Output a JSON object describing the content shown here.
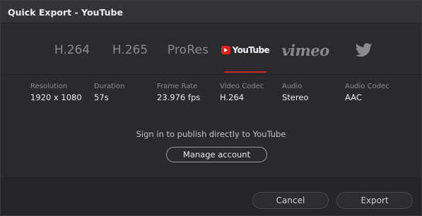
{
  "window": {
    "title": "Quick Export - YouTube"
  },
  "tabs": [
    {
      "label": "H.264",
      "icon": null,
      "selected": false
    },
    {
      "label": "H.265",
      "icon": null,
      "selected": false
    },
    {
      "label": "ProRes",
      "icon": null,
      "selected": false
    },
    {
      "label": "YouTube",
      "icon": "youtube-logo",
      "selected": true
    },
    {
      "label": "vimeo",
      "icon": "vimeo-logo",
      "selected": false
    },
    {
      "label": "",
      "icon": "twitter-bird-icon",
      "selected": false
    }
  ],
  "details": {
    "resolution": {
      "label": "Resolution",
      "value": "1920 x 1080"
    },
    "duration": {
      "label": "Duration",
      "value": "57s"
    },
    "frame_rate": {
      "label": "Frame Rate",
      "value": "23.976 fps"
    },
    "video_codec": {
      "label": "Video Codec",
      "value": "H.264"
    },
    "audio": {
      "label": "Audio",
      "value": "Stereo"
    },
    "audio_codec": {
      "label": "Audio Codec",
      "value": "AAC"
    }
  },
  "account": {
    "message": "Sign in to publish directly to YouTube",
    "manage_label": "Manage account"
  },
  "footer": {
    "cancel_label": "Cancel",
    "export_label": "Export"
  },
  "colors": {
    "accent_underline": "#c8262a",
    "youtube_red": "#e62117",
    "background": "#2a2a2c"
  }
}
